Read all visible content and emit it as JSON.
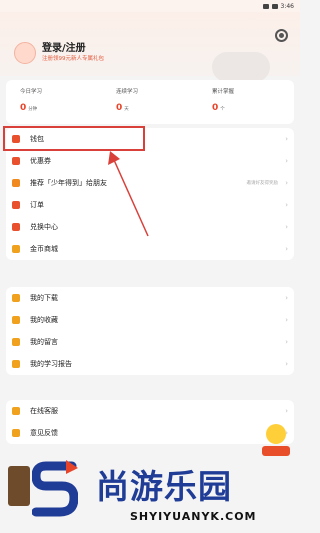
{
  "status_bar": {
    "time": "3:46"
  },
  "profile": {
    "login_title": "登录/注册",
    "login_sub": "注册领99元新人专属礼包"
  },
  "stats": [
    {
      "label": "今日学习",
      "value": "0",
      "unit": "分钟"
    },
    {
      "label": "连续学习",
      "value": "0",
      "unit": "天"
    },
    {
      "label": "累计掌握",
      "value": "0",
      "unit": "个"
    }
  ],
  "menu_group1": [
    {
      "label": "钱包",
      "icon": "wallet-icon",
      "color": "#e8502e"
    },
    {
      "label": "优惠券",
      "icon": "coupon-icon",
      "color": "#e8502e"
    },
    {
      "label": "推荐「少年得到」给朋友",
      "icon": "recommend-icon",
      "color": "#f08a1e",
      "hint": "邀请好友得奖励"
    },
    {
      "label": "订单",
      "icon": "order-icon",
      "color": "#e8502e"
    },
    {
      "label": "兑换中心",
      "icon": "exchange-icon",
      "color": "#e8502e"
    },
    {
      "label": "金币商城",
      "icon": "coin-shop-icon",
      "color": "#f0a21e"
    }
  ],
  "menu_group2": [
    {
      "label": "我的下载",
      "icon": "download-icon",
      "color": "#f0a21e"
    },
    {
      "label": "我的收藏",
      "icon": "favorite-icon",
      "color": "#f0a21e"
    },
    {
      "label": "我的留言",
      "icon": "message-icon",
      "color": "#f0a21e"
    },
    {
      "label": "我的学习报告",
      "icon": "report-icon",
      "color": "#f0a21e"
    }
  ],
  "menu_group3": [
    {
      "label": "在线客服",
      "icon": "service-icon",
      "color": "#f0a21e"
    },
    {
      "label": "意见反馈",
      "icon": "feedback-icon",
      "color": "#f0a21e"
    }
  ],
  "watermark": {
    "text": "尚游乐园",
    "url": "SHYIYUANYK.COM"
  },
  "colors": {
    "accent": "#e8442a",
    "highlight": "#d9403a",
    "watermark_blue": "#1f3c97"
  }
}
